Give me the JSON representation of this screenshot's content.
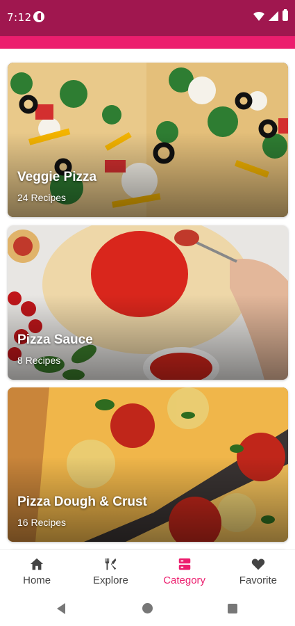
{
  "status": {
    "time": "7:12"
  },
  "categories": [
    {
      "title": "Veggie Pizza",
      "count": "24 Recipes"
    },
    {
      "title": "Pizza Sauce",
      "count": "8 Recipes"
    },
    {
      "title": "Pizza Dough & Crust",
      "count": "16 Recipes"
    }
  ],
  "bottom_nav": {
    "items": [
      {
        "label": "Home",
        "icon": "home-icon"
      },
      {
        "label": "Explore",
        "icon": "fork-knife-icon"
      },
      {
        "label": "Category",
        "icon": "category-icon"
      },
      {
        "label": "Favorite",
        "icon": "heart-icon"
      }
    ],
    "active": "Category"
  },
  "colors": {
    "status_bar": "#a0174f",
    "accent": "#ec1e6e"
  }
}
